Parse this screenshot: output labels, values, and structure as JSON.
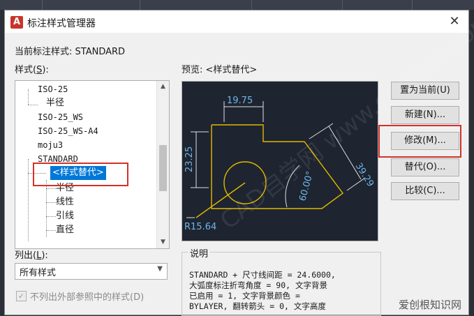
{
  "window": {
    "title": "标注样式管理器",
    "close_glyph": "✕",
    "app_icon_letter": "A"
  },
  "current_style": {
    "label": "当前标注样式: STANDARD"
  },
  "styles_list": {
    "label_prefix": "样式(",
    "label_key": "S",
    "label_suffix": "):",
    "items": [
      {
        "text": "ISO-25"
      },
      {
        "text": "半径"
      },
      {
        "text": "ISO-25_WS"
      },
      {
        "text": "ISO-25_WS-A4"
      },
      {
        "text": "moju3"
      },
      {
        "text": "STANDARD"
      },
      {
        "text": "<样式替代>"
      },
      {
        "text": "半径"
      },
      {
        "text": "线性"
      },
      {
        "text": "引线"
      },
      {
        "text": "直径"
      }
    ]
  },
  "preview": {
    "label": "预览: <样式替代>",
    "dims": {
      "top": "19.75",
      "left": "23.25",
      "diag": "39.29",
      "angle": "60.00°",
      "radius": "R15.64"
    }
  },
  "buttons": {
    "set_current": "置为当前(U)",
    "new": "新建(N)...",
    "modify": "修改(M)...",
    "override": "替代(O)...",
    "compare": "比较(C)..."
  },
  "list_filter": {
    "label_prefix": "列出(",
    "label_key": "L",
    "label_suffix": "):",
    "selected": "所有样式"
  },
  "xref_checkbox": {
    "label": "不列出外部参照中的样式(D)",
    "checked": true
  },
  "description": {
    "label": "说明",
    "text": "STANDARD + 尺寸线间距 = 24.6000,\n大弧度标注折弯角度 = 90, 文字背景\n已启用 = 1, 文字背景颜色 =\nBYLAYER, 翻转箭头 = 0, 文字高度"
  },
  "watermarks": {
    "diagonal": "CAD自学网 www.cadzxw.com",
    "corner": "爱创根知识网"
  },
  "colors": {
    "accent": "#0078d7",
    "highlight_box": "#d3312a",
    "preview_bg": "#1e2430",
    "preview_line": "#e0b800",
    "dim_text": "#6fb7e6"
  }
}
